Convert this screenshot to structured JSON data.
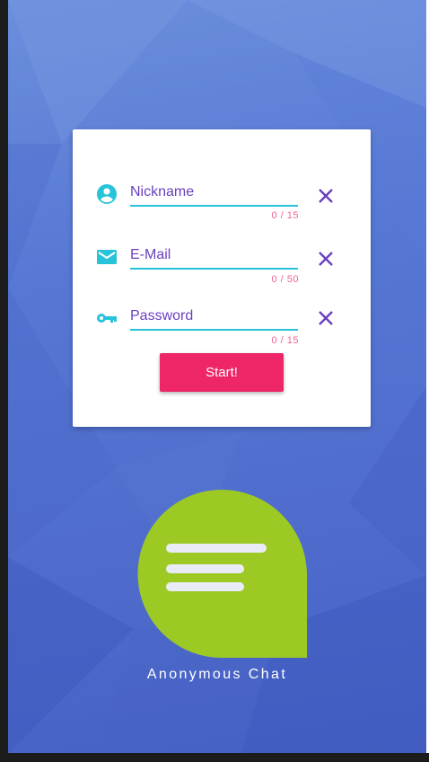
{
  "form": {
    "nickname": {
      "placeholder": "Nickname",
      "counter": "0 / 15",
      "icon": "account-circle-icon"
    },
    "email": {
      "placeholder": "E-Mail",
      "counter": "0 / 50",
      "icon": "email-icon"
    },
    "password": {
      "placeholder": "Password",
      "counter": "0 / 15",
      "icon": "key-icon"
    },
    "clear_icon": "close-icon",
    "start_label": "Start!"
  },
  "app": {
    "name": "Anonymous Chat",
    "logo_icon": "chat-bubble-icon"
  },
  "colors": {
    "background": "#5677d4",
    "accent_underline": "#26c3d9",
    "label_purple": "#6a3fbf",
    "counter_pink": "#f06292",
    "button_pink": "#ee2566",
    "logo_green": "#9dc925"
  }
}
